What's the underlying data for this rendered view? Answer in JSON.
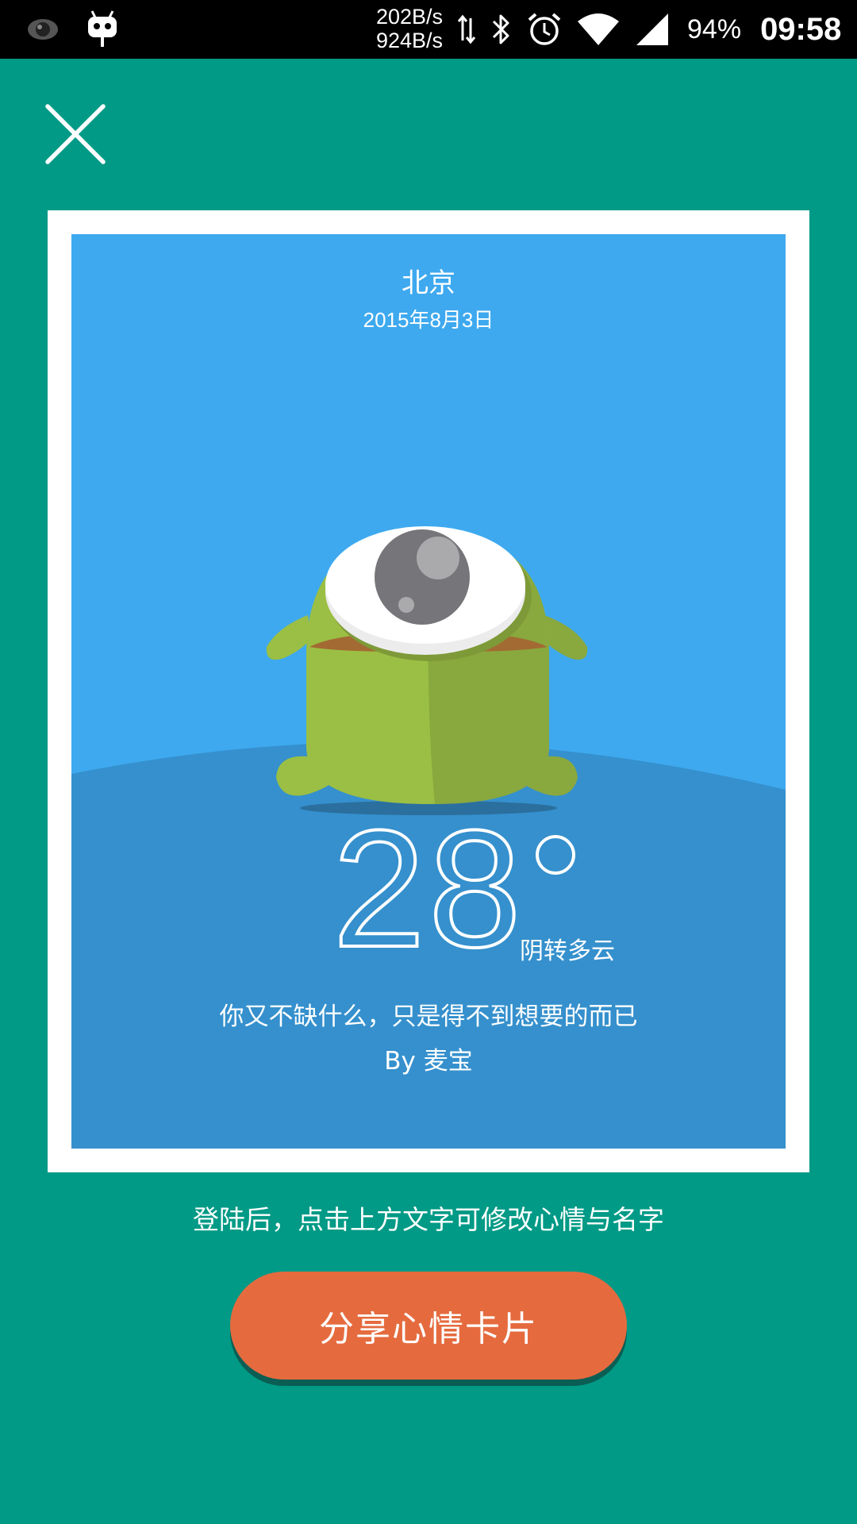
{
  "status_bar": {
    "net_up": "202B/s",
    "net_down": "924B/s",
    "battery": "94%",
    "time": "09:58",
    "icons": [
      "eye-icon",
      "android-robot-icon",
      "data-transfer-icon",
      "bluetooth-icon",
      "alarm-icon",
      "wifi-icon",
      "cell-signal-icon"
    ]
  },
  "header": {
    "close_icon": "close-icon"
  },
  "card": {
    "city": "北京",
    "date": "2015年8月3日",
    "temperature": "28",
    "weather": "阴转多云",
    "mood": "你又不缺什么，只是得不到想要的而已",
    "author": "By 麦宝",
    "illustration": "green-one-eyed-monster"
  },
  "hint": "登陆后，点击上方文字可修改心情与名字",
  "share_button": "分享心情卡片",
  "colors": {
    "background": "#009A86",
    "sky": "#3EA9EF",
    "ground": "#3590CD",
    "button": "#E56B3E",
    "monster_green": "#9BBF44"
  }
}
